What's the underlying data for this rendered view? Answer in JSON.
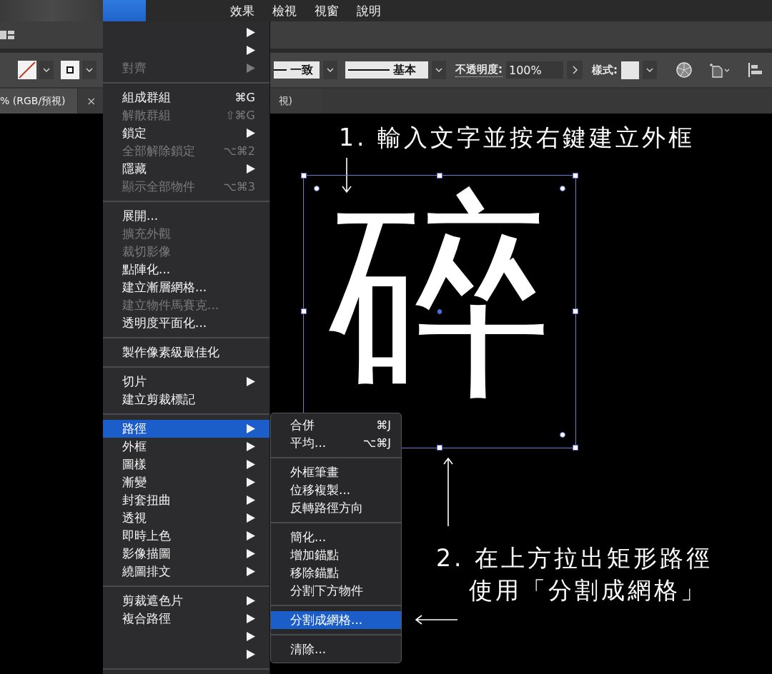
{
  "menu_bar": {
    "items": [
      "效果",
      "檢視",
      "視窗",
      "說明"
    ]
  },
  "control_bar": {
    "stroke_profile": "一致",
    "brush": "基本",
    "opacity_label": "不透明度:",
    "opacity_value": "100%",
    "style_label": "樣式:"
  },
  "document_tabs": [
    {
      "title": "% (RGB/預視)",
      "selected": true
    },
    {
      "close": "×",
      "title": "視)",
      "selected": false
    }
  ],
  "menu": {
    "items": [
      {
        "kind": "item",
        "submenu": true,
        "disabled": false,
        "selected": false
      },
      {
        "kind": "item",
        "submenu": true,
        "disabled": false,
        "selected": false
      },
      {
        "kind": "item",
        "label": "對齊",
        "submenu": true,
        "disabled": true,
        "selected": false
      },
      {
        "kind": "separator"
      },
      {
        "kind": "item",
        "label": "組成群組",
        "shortcut": "⌘G",
        "submenu": false,
        "disabled": false,
        "selected": false
      },
      {
        "kind": "item",
        "label": "解散群組",
        "shortcut": "⇧⌘G",
        "submenu": false,
        "disabled": true,
        "selected": false
      },
      {
        "kind": "item",
        "label": "鎖定",
        "submenu": true,
        "disabled": false,
        "selected": false
      },
      {
        "kind": "item",
        "label": "全部解除鎖定",
        "shortcut": "⌥⌘2",
        "submenu": false,
        "disabled": true,
        "selected": false
      },
      {
        "kind": "item",
        "label": "隱藏",
        "submenu": true,
        "disabled": false,
        "selected": false
      },
      {
        "kind": "item",
        "label": "顯示全部物件",
        "shortcut": "⌥⌘3",
        "submenu": false,
        "disabled": true,
        "selected": false
      },
      {
        "kind": "separator"
      },
      {
        "kind": "item",
        "label": "展開...",
        "submenu": false,
        "disabled": false,
        "selected": false
      },
      {
        "kind": "item",
        "label": "擴充外觀",
        "submenu": false,
        "disabled": true,
        "selected": false
      },
      {
        "kind": "item",
        "label": "裁切影像",
        "submenu": false,
        "disabled": true,
        "selected": false
      },
      {
        "kind": "item",
        "label": "點陣化...",
        "submenu": false,
        "disabled": false,
        "selected": false
      },
      {
        "kind": "item",
        "label": "建立漸層網格...",
        "submenu": false,
        "disabled": false,
        "selected": false
      },
      {
        "kind": "item",
        "label": "建立物件馬賽克...",
        "submenu": false,
        "disabled": true,
        "selected": false
      },
      {
        "kind": "item",
        "label": "透明度平面化...",
        "submenu": false,
        "disabled": false,
        "selected": false
      },
      {
        "kind": "separator"
      },
      {
        "kind": "item",
        "label": "製作像素級最佳化",
        "submenu": false,
        "disabled": false,
        "selected": false
      },
      {
        "kind": "separator"
      },
      {
        "kind": "item",
        "label": "切片",
        "submenu": true,
        "disabled": false,
        "selected": false
      },
      {
        "kind": "item",
        "label": "建立剪裁標記",
        "submenu": false,
        "disabled": false,
        "selected": false
      },
      {
        "kind": "separator"
      },
      {
        "kind": "item",
        "label": "路徑",
        "submenu": true,
        "disabled": false,
        "selected": true
      },
      {
        "kind": "item",
        "label": "外框",
        "submenu": true,
        "disabled": false,
        "selected": false
      },
      {
        "kind": "item",
        "label": "圖樣",
        "submenu": true,
        "disabled": false,
        "selected": false
      },
      {
        "kind": "item",
        "label": "漸變",
        "submenu": true,
        "disabled": false,
        "selected": false
      },
      {
        "kind": "item",
        "label": "封套扭曲",
        "submenu": true,
        "disabled": false,
        "selected": false
      },
      {
        "kind": "item",
        "label": "透視",
        "submenu": true,
        "disabled": false,
        "selected": false
      },
      {
        "kind": "item",
        "label": "即時上色",
        "submenu": true,
        "disabled": false,
        "selected": false
      },
      {
        "kind": "item",
        "label": "影像描圖",
        "submenu": true,
        "disabled": false,
        "selected": false
      },
      {
        "kind": "item",
        "label": "繞圖排文",
        "submenu": true,
        "disabled": false,
        "selected": false
      },
      {
        "kind": "separator"
      },
      {
        "kind": "item",
        "label": "剪裁遮色片",
        "submenu": true,
        "disabled": false,
        "selected": false
      },
      {
        "kind": "item",
        "label": "複合路徑",
        "submenu": true,
        "disabled": false,
        "selected": false
      },
      {
        "kind": "item",
        "submenu": true,
        "disabled": false,
        "selected": false
      },
      {
        "kind": "item",
        "submenu": true,
        "disabled": false,
        "selected": false
      },
      {
        "kind": "separator"
      }
    ]
  },
  "submenu": {
    "items": [
      {
        "kind": "item",
        "label": "合併",
        "shortcut": "⌘J",
        "disabled": false,
        "selected": false
      },
      {
        "kind": "item",
        "label": "平均...",
        "shortcut": "⌥⌘J",
        "disabled": false,
        "selected": false
      },
      {
        "kind": "separator"
      },
      {
        "kind": "item",
        "label": "外框筆畫",
        "disabled": false,
        "selected": false
      },
      {
        "kind": "item",
        "label": "位移複製...",
        "disabled": false,
        "selected": false
      },
      {
        "kind": "item",
        "label": "反轉路徑方向",
        "disabled": false,
        "selected": false
      },
      {
        "kind": "separator"
      },
      {
        "kind": "item",
        "label": "簡化...",
        "disabled": false,
        "selected": false
      },
      {
        "kind": "item",
        "label": "增加錨點",
        "disabled": false,
        "selected": false
      },
      {
        "kind": "item",
        "label": "移除錨點",
        "disabled": false,
        "selected": false
      },
      {
        "kind": "item",
        "label": "分割下方物件",
        "disabled": false,
        "selected": false
      },
      {
        "kind": "separator"
      },
      {
        "kind": "item",
        "label": "分割成網格...",
        "disabled": false,
        "selected": true
      },
      {
        "kind": "separator"
      },
      {
        "kind": "item",
        "label": "清除...",
        "disabled": false,
        "selected": false
      }
    ]
  },
  "canvas": {
    "artwork_text": "碎",
    "step_1": {
      "lines": [
        "1. 輸入文字並按右鍵建立外框"
      ]
    },
    "step_2": {
      "lines": [
        "2. 在上方拉出矩形路徑",
        "使用「分割成網格」"
      ]
    }
  }
}
